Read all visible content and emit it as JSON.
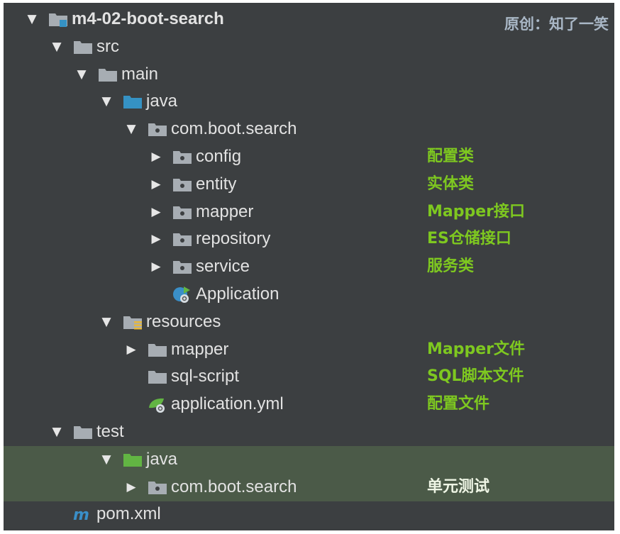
{
  "watermark": "原创：知了一笑",
  "colors": {
    "panel_bg": "#3c3f41",
    "test_highlight": "#4b5a48",
    "annotation_green": "#7ec820",
    "text": "#e2e2e2",
    "folder_gray": "#a7adb3",
    "folder_source_blue": "#3592c4",
    "folder_test_green": "#62b543"
  },
  "tree": [
    {
      "label": "m4-02-boot-search",
      "icon": "module-folder-icon",
      "arrow": "expanded",
      "bold": true
    },
    {
      "label": "src",
      "icon": "folder-icon",
      "arrow": "expanded"
    },
    {
      "label": "main",
      "icon": "folder-icon",
      "arrow": "expanded"
    },
    {
      "label": "java",
      "icon": "source-root-folder-icon",
      "arrow": "expanded"
    },
    {
      "label": "com.boot.search",
      "icon": "package-icon",
      "arrow": "expanded"
    },
    {
      "label": "config",
      "icon": "package-icon",
      "arrow": "collapsed",
      "note": "配置类"
    },
    {
      "label": "entity",
      "icon": "package-icon",
      "arrow": "collapsed",
      "note": "实体类"
    },
    {
      "label": "mapper",
      "icon": "package-icon",
      "arrow": "collapsed",
      "note": "Mapper接口"
    },
    {
      "label": "repository",
      "icon": "package-icon",
      "arrow": "collapsed",
      "note": "ES仓储接口"
    },
    {
      "label": "service",
      "icon": "package-icon",
      "arrow": "collapsed",
      "note": "服务类"
    },
    {
      "label": "Application",
      "icon": "spring-boot-class-icon",
      "arrow": "none"
    },
    {
      "label": "resources",
      "icon": "resources-folder-icon",
      "arrow": "expanded"
    },
    {
      "label": "mapper",
      "icon": "folder-icon",
      "arrow": "collapsed",
      "note": "Mapper文件"
    },
    {
      "label": "sql-script",
      "icon": "folder-icon",
      "arrow": "none",
      "note": "SQL脚本文件"
    },
    {
      "label": "application.yml",
      "icon": "spring-config-file-icon",
      "arrow": "none",
      "note": "配置文件"
    },
    {
      "label": "test",
      "icon": "folder-icon",
      "arrow": "expanded"
    },
    {
      "label": "java",
      "icon": "test-root-folder-icon",
      "arrow": "expanded",
      "highlighted": true
    },
    {
      "label": "com.boot.search",
      "icon": "package-icon",
      "arrow": "collapsed",
      "highlighted": true,
      "note": "单元测试"
    },
    {
      "label": "pom.xml",
      "icon": "maven-file-icon",
      "arrow": "none"
    }
  ]
}
